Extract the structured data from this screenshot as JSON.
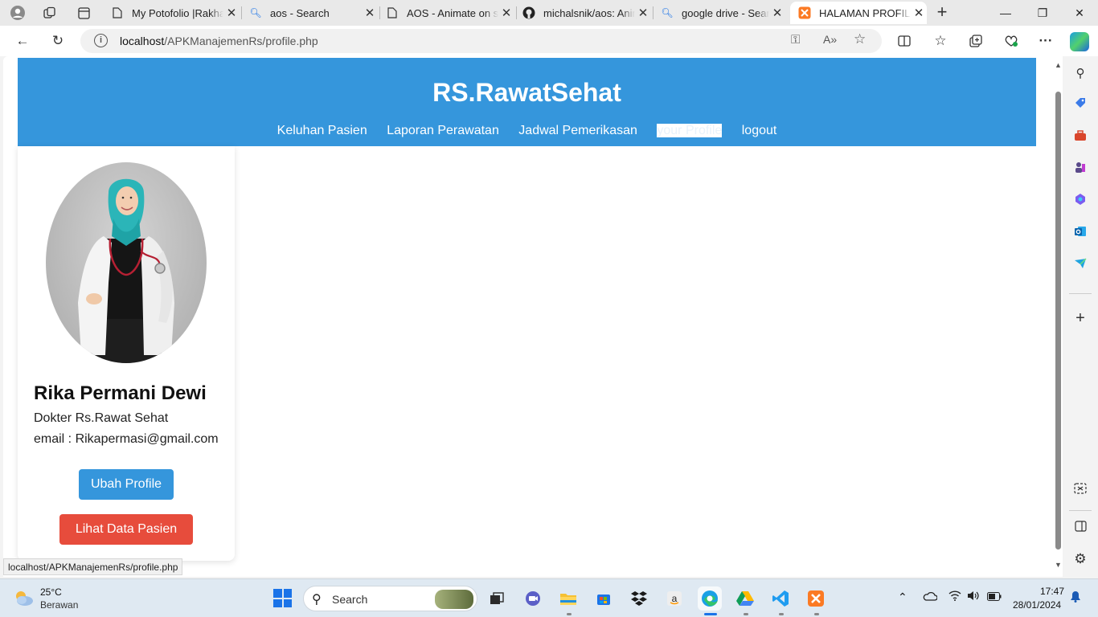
{
  "browser": {
    "tabs": [
      {
        "title": "My Potofolio |Rakha",
        "icon": "document-icon"
      },
      {
        "title": "aos - Search",
        "icon": "search-icon"
      },
      {
        "title": "AOS - Animate on scroll",
        "icon": "document-icon"
      },
      {
        "title": "michalsnik/aos: Animate",
        "icon": "github-icon"
      },
      {
        "title": "google drive - Search",
        "icon": "search-icon"
      },
      {
        "title": "HALAMAN PROFILE",
        "icon": "xampp-icon",
        "active": true
      }
    ],
    "address": {
      "host": "localhost",
      "path": "/APKManajemenRs/profile.php"
    },
    "status_url": "localhost/APKManajemenRs/profile.php"
  },
  "site": {
    "title": "RS.RawatSehat",
    "nav": [
      {
        "label": "Keluhan Pasien"
      },
      {
        "label": "Laporan Perawatan"
      },
      {
        "label": "Jadwal Pemerikasan"
      },
      {
        "label": "your Profile",
        "active": true
      },
      {
        "label": "logout"
      }
    ],
    "header_color": "#3596dc"
  },
  "profile": {
    "name": "Rika Permani Dewi",
    "role": "Dokter Rs.Rawat Sehat",
    "email": "email : Rikapermasi@gmail.com",
    "edit_label": "Ubah Profile",
    "patients_label": "Lihat Data Pasien",
    "edit_color": "#3596dc",
    "patients_color": "#e74c3c"
  },
  "taskbar": {
    "weather_temp": "25°C",
    "weather_desc": "Berawan",
    "search_label": "Search",
    "time": "17:47",
    "date": "28/01/2024"
  }
}
